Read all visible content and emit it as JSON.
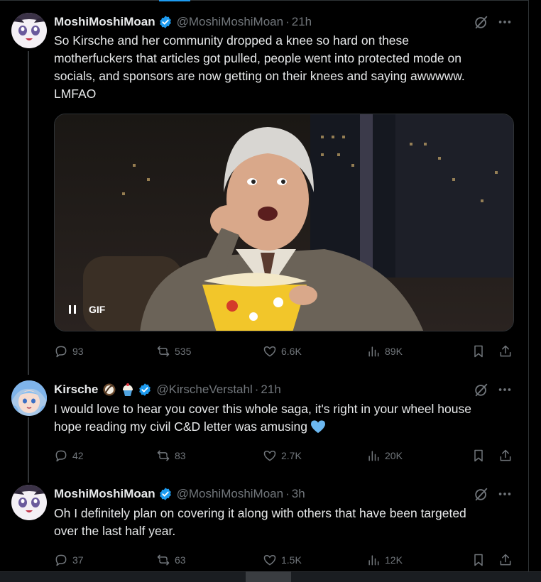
{
  "tweets": [
    {
      "name": "MoshiMoshiMoan",
      "handle": "@MoshiMoshiMoan",
      "time": "21h",
      "text_lines": [
        "So Kirsche and her community dropped a knee so hard on these",
        "motherfuckers that articles got pulled, people went into protected mode on",
        "socials, and sponsors are now getting on their knees and saying awwwww.",
        "LMFAO"
      ],
      "media_badge": "GIF",
      "stats": {
        "replies": "93",
        "reposts": "535",
        "likes": "6.6K",
        "views": "89K"
      }
    },
    {
      "name": "Kirsche",
      "handle": "@KirscheVerstahl",
      "time": "21h",
      "name_emojis": [
        "coconut-emoji",
        "cupcake-emoji"
      ],
      "text_lines": [
        "I would love to hear you cover this whole saga, it's right in your wheel house",
        "hope reading my civil C&D letter was amusing"
      ],
      "text_emoji": "blue-heart-emoji",
      "stats": {
        "replies": "42",
        "reposts": "83",
        "likes": "2.7K",
        "views": "20K"
      }
    },
    {
      "name": "MoshiMoshiMoan",
      "handle": "@MoshiMoshiMoan",
      "time": "3h",
      "text_lines": [
        "Oh I definitely plan on covering it along with others that have been targeted",
        "over the last half year."
      ],
      "stats": {
        "replies": "37",
        "reposts": "63",
        "likes": "1.5K",
        "views": "12K"
      }
    }
  ],
  "colors": {
    "accent": "#1d9bf0",
    "muted": "#71767b",
    "text": "#e7e9ea",
    "background": "#000000"
  }
}
